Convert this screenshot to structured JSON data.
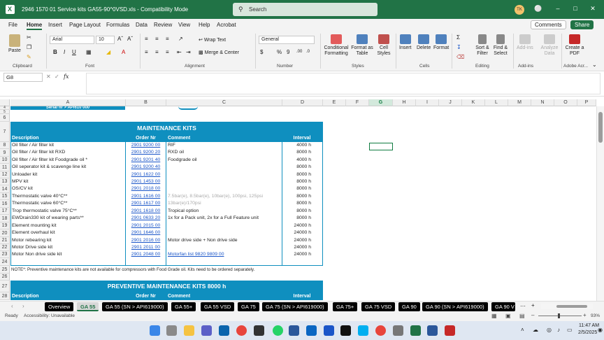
{
  "window": {
    "title": "2946 1570 01 Service kits GA55-90^0VSD.xls  -  Compatibility Mode",
    "search_placeholder": "Search",
    "avatar_initials": "TK"
  },
  "menu_tabs": [
    "File",
    "Home",
    "Insert",
    "Page Layout",
    "Formulas",
    "Data",
    "Review",
    "View",
    "Help",
    "Acrobat"
  ],
  "active_tab": "Home",
  "header_buttons": {
    "comments": "Comments",
    "share": "Share"
  },
  "ribbon": {
    "paste": "Paste",
    "font_name": "Arial",
    "font_size": "10",
    "wrap_text": "Wrap Text",
    "merge_center": "Merge & Center",
    "number_format": "General",
    "conditional_formatting": "Conditional Formatting",
    "format_as_table": "Format as Table",
    "cell_styles": "Cell Styles",
    "insert": "Insert",
    "delete": "Delete",
    "format": "Format",
    "sort_filter": "Sort & Filter",
    "find_select": "Find & Select",
    "addins": "Add-ins",
    "analyze_data": "Analyze Data",
    "create_pdf": "Create a PDF",
    "groups": [
      "Clipboard",
      "Font",
      "Alignment",
      "Number",
      "Styles",
      "Cells",
      "Editing",
      "Add-ins",
      "Adobe Acr..."
    ]
  },
  "formula_bar": {
    "name_box": "G8",
    "fx": "fx",
    "content": ""
  },
  "columns": [
    "A",
    "B",
    "C",
    "D",
    "E",
    "F",
    "G",
    "H",
    "I",
    "J",
    "K",
    "L",
    "M",
    "N",
    "O",
    "P"
  ],
  "selected_column": "G",
  "rows": [
    "4",
    "5",
    "6",
    "7",
    "8",
    "9",
    "10",
    "11",
    "12",
    "13",
    "14",
    "15",
    "16",
    "17",
    "18",
    "19",
    "20",
    "21",
    "22",
    "23",
    "24",
    "25",
    "26",
    "27",
    "28"
  ],
  "sheet": {
    "serial_text": "Serial nr > API610 000",
    "maintenance_title": "MAINTENANCE KITS",
    "headers": {
      "description": "Description",
      "order_nr": "Order Nr",
      "comment": "Comment",
      "interval": "Interval"
    },
    "kits": [
      {
        "desc": "Oil filter / Air filter kit",
        "order": "2901 9200 00",
        "comment": "RIF",
        "grey": false,
        "interval": "4000 h"
      },
      {
        "desc": "Oil filter / Air filter kit RXD",
        "order": "2901 9200 20",
        "comment": "RXD oil",
        "grey": false,
        "interval": "8000 h"
      },
      {
        "desc": "Oil filter / Air filter kit Foodgrade oil *",
        "order": "2901 9201 40",
        "comment": "Foodgrade oil",
        "grey": false,
        "interval": "4000 h"
      },
      {
        "desc": "Oil seperator kit & scavenge line kit",
        "order": "2901 9200 40",
        "comment": "",
        "grey": false,
        "interval": "8000 h"
      },
      {
        "desc": "Unloader kit",
        "order": "2901 1622 00",
        "comment": "",
        "grey": false,
        "interval": "8000 h"
      },
      {
        "desc": "MPV kit",
        "order": "2901 1453 00",
        "comment": "",
        "grey": false,
        "interval": "8000 h"
      },
      {
        "desc": "OS/CV kit",
        "order": "2901 2018 00",
        "comment": "",
        "grey": false,
        "interval": "8000 h"
      },
      {
        "desc": "Thermostatic valve 40°C**",
        "order": "2901 1616 00",
        "comment": "7.5bar(e), 8.5bar(e), 10bar(e), 100psi, 125psi",
        "grey": true,
        "interval": "8000 h"
      },
      {
        "desc": "Thermostatic valve 60°C**",
        "order": "2901 1617 00",
        "comment": "13bar(e)/170psi",
        "grey": true,
        "interval": "8000 h"
      },
      {
        "desc": "Trop thermostatic valve 75°C**",
        "order": "2901 1618 00",
        "comment": "Tropical option",
        "grey": false,
        "interval": "8000 h"
      },
      {
        "desc": "EWDrain330 kit of wearing parts**",
        "order": "2901 0633 20",
        "comment": "1x for a Pack unit, 2x for a Full Feature unit",
        "grey": false,
        "interval": "8000 h"
      },
      {
        "desc": "Element mounting kit",
        "order": "2901 2015 00",
        "comment": "",
        "grey": false,
        "interval": "24000 h"
      },
      {
        "desc": "Element overhaul kit",
        "order": "2901 1646 00",
        "comment": "",
        "grey": false,
        "interval": "24000 h"
      },
      {
        "desc": "Motor rebearing kit",
        "order": "2901 2016 00",
        "comment": "Motor drive side + Non drive side",
        "grey": false,
        "interval": "24000 h"
      },
      {
        "desc": "   Motor Drive side kit",
        "order": "2901 2011 00",
        "comment": "",
        "grey": false,
        "interval": "24000 h"
      },
      {
        "desc": "   Motor Non drive side kit",
        "order": "2901 2048 00",
        "comment": "Motorfan list 9820 9809 00",
        "grey": false,
        "link_comment": true,
        "interval": "24000 h"
      }
    ],
    "note": "NOTE*: Preventive maintenance kits are not available for compressors with Food Grade oil. Kits need to be ordered separately.",
    "preventive_title": "PREVENTIVE MAINTENANCE KITS  8000 h"
  },
  "sheet_tabs": [
    "Overview",
    "GA 55",
    "GA 55 (SN > API619000)",
    "GA 55+",
    "GA 55 VSD",
    "GA 75",
    "GA 75 (SN > API619000)",
    "GA 75+",
    "GA 75 VSD",
    "GA 90",
    "GA 90 (SN > API619000)",
    "GA 90 V"
  ],
  "active_sheet": "GA 55",
  "status": {
    "ready": "Ready",
    "accessibility": "Accessibility: Unavailable",
    "zoom": "93%"
  },
  "taskbar": {
    "time": "11:47 AM",
    "date": "2/5/2025"
  },
  "colors": {
    "excel_green": "#217346",
    "banner_teal": "#0f8fbf",
    "link_blue": "#1a55c8"
  }
}
